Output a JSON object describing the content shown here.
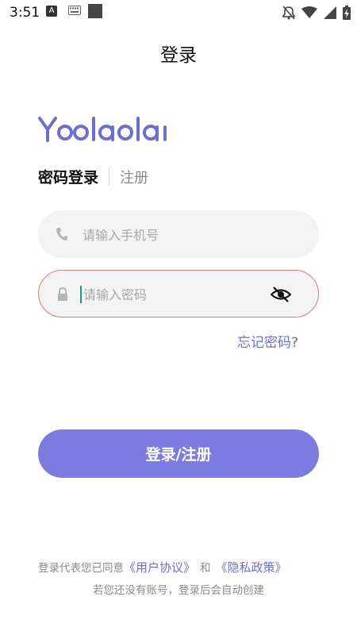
{
  "status_bar": {
    "time": "3:51",
    "left_icons": [
      "a-icon",
      "keyboard-icon",
      "square-icon"
    ],
    "right_icons": [
      "notifications-off-icon",
      "wifi-icon",
      "signal-icon",
      "battery-charging-icon"
    ]
  },
  "header": {
    "title": "登录"
  },
  "logo": {
    "text": "Yoolaola",
    "color": "#6c6fd0"
  },
  "tabs": {
    "active": "密码登录",
    "inactive": "注册"
  },
  "phone_field": {
    "placeholder": "请输入手机号",
    "icon": "phone-icon"
  },
  "password_field": {
    "placeholder": "请输入密码",
    "icon": "lock-icon",
    "toggle_icon": "eye-hidden-icon"
  },
  "forgot_link": "忘记密码?",
  "submit_button": {
    "label": "登录/注册",
    "color": "#7b7be0"
  },
  "agreement": {
    "prefix": "登录代表您已同意",
    "user_agreement": "《用户协议》",
    "and": "和",
    "privacy_policy": "《隐私政策》",
    "note": "若您还没有账号，登录后会自动创建"
  },
  "colors": {
    "accent": "#6c6fd0",
    "error_border": "#e07a7a",
    "caret": "#1a9e86"
  }
}
